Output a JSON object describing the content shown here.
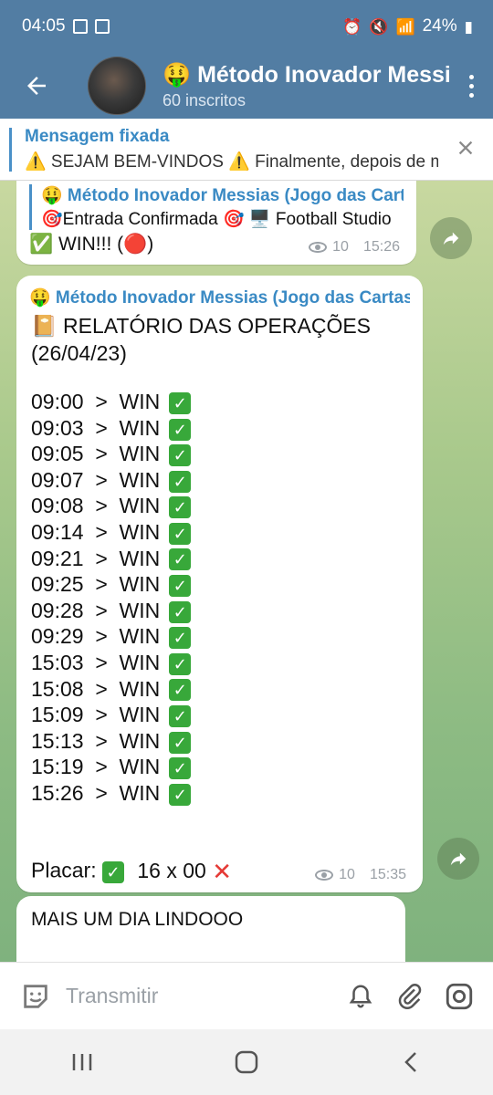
{
  "status_bar": {
    "time": "04:05",
    "battery": "24%"
  },
  "header": {
    "title": "🤑 Método Inovador Messias",
    "subscribers": "60 inscritos"
  },
  "pinned": {
    "title": "Mensagem fixada",
    "body": "⚠️ SEJAM BEM-VINDOS ⚠️  Finalmente, depois de muito tempo"
  },
  "messages": [
    {
      "reply_author": "🤑 Método Inovador Messias (Jogo das Cartas)",
      "reply_text": "🎯Entrada Confirmada 🎯 🖥️ Football Studio",
      "text": "✅ WIN!!! (🔴)",
      "views": "10",
      "time": "15:26"
    },
    {
      "author": "🤑 Método Inovador Messias (Jogo das Cartas)",
      "header_line1": "📔  RELATÓRIO DAS OPERAÇÕES",
      "header_line2": "(26/04/23)",
      "results": [
        "09:00  >  WIN",
        "09:03  >  WIN",
        "09:05  >  WIN",
        "09:07  >  WIN",
        "09:08  >  WIN",
        "09:14  >  WIN",
        "09:21  >  WIN",
        "09:25  >  WIN",
        "09:28  >  WIN",
        "09:29  >  WIN",
        "15:03  >  WIN",
        "15:08  >  WIN",
        "15:09  >  WIN",
        "15:13  >  WIN",
        "15:19  >  WIN",
        "15:26  >  WIN"
      ],
      "score_label": "Placar:",
      "score_value": "16 x 00",
      "views": "10",
      "time": "15:35"
    },
    {
      "text": "MAIS UM DIA LINDOOO"
    }
  ],
  "input": {
    "placeholder": "Transmitir"
  },
  "icons": {
    "back": "arrow-left-icon",
    "menu": "more-vert-icon",
    "close": "close-icon",
    "share": "share-icon",
    "emoji": "sticker-icon",
    "bell": "bell-icon",
    "attach": "paperclip-icon",
    "camera": "instagram-camera-icon"
  }
}
